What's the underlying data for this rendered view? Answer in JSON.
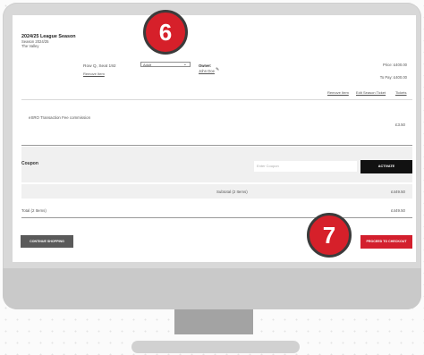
{
  "event": {
    "title": "2024/25 League Season",
    "subtitle": "Season 2024/25",
    "venue": "The Valley"
  },
  "ticket": {
    "seat": "Row Q, Seat 192",
    "remove_label": "Remove Item",
    "ticket_type": "Adult",
    "owner_label": "Owner:",
    "owner_name": "John Doe",
    "price_label": "Price: £400.00",
    "to_pay_label": "To Pay: £400.00"
  },
  "item_actions": [
    "Remove Item",
    "Edit Season Ticket",
    "Tickets"
  ],
  "fee": {
    "label": "eSRO Transaction Fee commission",
    "amount": "£3.50"
  },
  "coupon": {
    "label": "Coupon",
    "placeholder": "Enter Coupon",
    "button_label": "ACTIVATE"
  },
  "subtotal": {
    "label": "Subtotal (2 Items)",
    "amount": "£449.50"
  },
  "total": {
    "label": "Total (2 Items)",
    "amount": "£449.50"
  },
  "buttons": {
    "continue": "CONTINUE SHOPPING",
    "checkout": "PROCEED TO CHECKOUT"
  },
  "steps": [
    "6",
    "7"
  ],
  "colors": {
    "accent_red": "#d31f2d",
    "badge_red": "#d6202a",
    "dark_button": "#111111",
    "gray_button": "#5a5a5a"
  },
  "icons": {
    "owner_edit": "pencil-icon",
    "ticket_type_dropdown": "chevron-down-icon"
  }
}
